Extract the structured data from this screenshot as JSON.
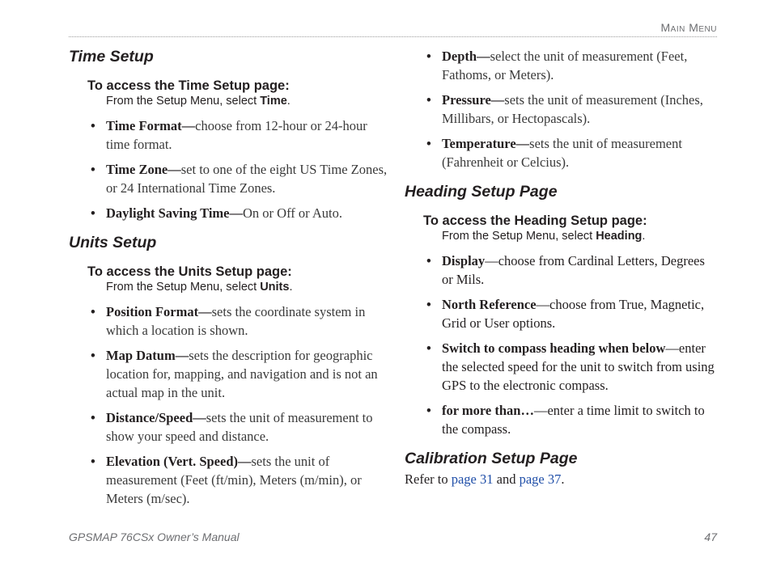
{
  "header": {
    "section": "Main Menu"
  },
  "left": {
    "time": {
      "heading": "Time Setup",
      "access": "To access the Time Setup page:",
      "from_prefix": "From the Setup Menu, select ",
      "from_item": "Time",
      "items": [
        {
          "term": "Time Format—",
          "desc": "choose from 12-hour or 24-hour time format."
        },
        {
          "term": "Time Zone—",
          "desc": "set to one of the eight US Time Zones, or 24 International Time Zones."
        },
        {
          "term": "Daylight Saving Time—",
          "desc": "On or Off or Auto."
        }
      ]
    },
    "units": {
      "heading": "Units Setup",
      "access": "To access the Units Setup page:",
      "from_prefix": "From the Setup Menu, select ",
      "from_item": "Units",
      "items": [
        {
          "term": "Position Format—",
          "desc": "sets the coordinate system in which a location is shown."
        },
        {
          "term": "Map Datum—",
          "desc": "sets the description for geographic location for, mapping, and navigation and is not an actual map in the unit."
        },
        {
          "term": "Distance/Speed—",
          "desc": "sets the unit of measurement to show your speed and distance."
        },
        {
          "term": "Elevation (Vert. Speed)—",
          "desc": "sets the unit of measurement (Feet (ft/min), Meters (m/min), or Meters (m/sec)."
        }
      ]
    }
  },
  "right": {
    "units_cont": {
      "items": [
        {
          "term": "Depth—",
          "desc": "select the unit of measurement (Feet, Fathoms, or Meters)."
        },
        {
          "term": "Pressure—",
          "desc": "sets the unit of measurement (Inches, Millibars, or Hectopascals)."
        },
        {
          "term": "Temperature—",
          "desc": "sets the unit of measurement (Fahrenheit or Celcius)."
        }
      ]
    },
    "heading_setup": {
      "heading": "Heading Setup Page",
      "access": "To access the Heading Setup page:",
      "from_prefix": "From the Setup Menu, select ",
      "from_item": "Heading",
      "items": [
        {
          "term": "Display",
          "desc": "—choose from Cardinal Letters, Degrees or Mils."
        },
        {
          "term": "North Reference",
          "desc": "—choose from True, Magnetic, Grid or User options."
        },
        {
          "term": "Switch to compass heading when below",
          "desc": "—enter the selected speed for the unit to switch from using GPS to the electronic compass."
        },
        {
          "term": "for more than…",
          "desc": "—enter a time limit to switch to the compass."
        }
      ]
    },
    "calibration": {
      "heading": "Calibration Setup Page",
      "refer_prefix": "Refer to ",
      "link1": "page 31",
      "and": " and ",
      "link2": "page 37",
      "period": "."
    }
  },
  "footer": {
    "manual": "GPSMAP 76CSx Owner’s Manual",
    "page": "47"
  }
}
